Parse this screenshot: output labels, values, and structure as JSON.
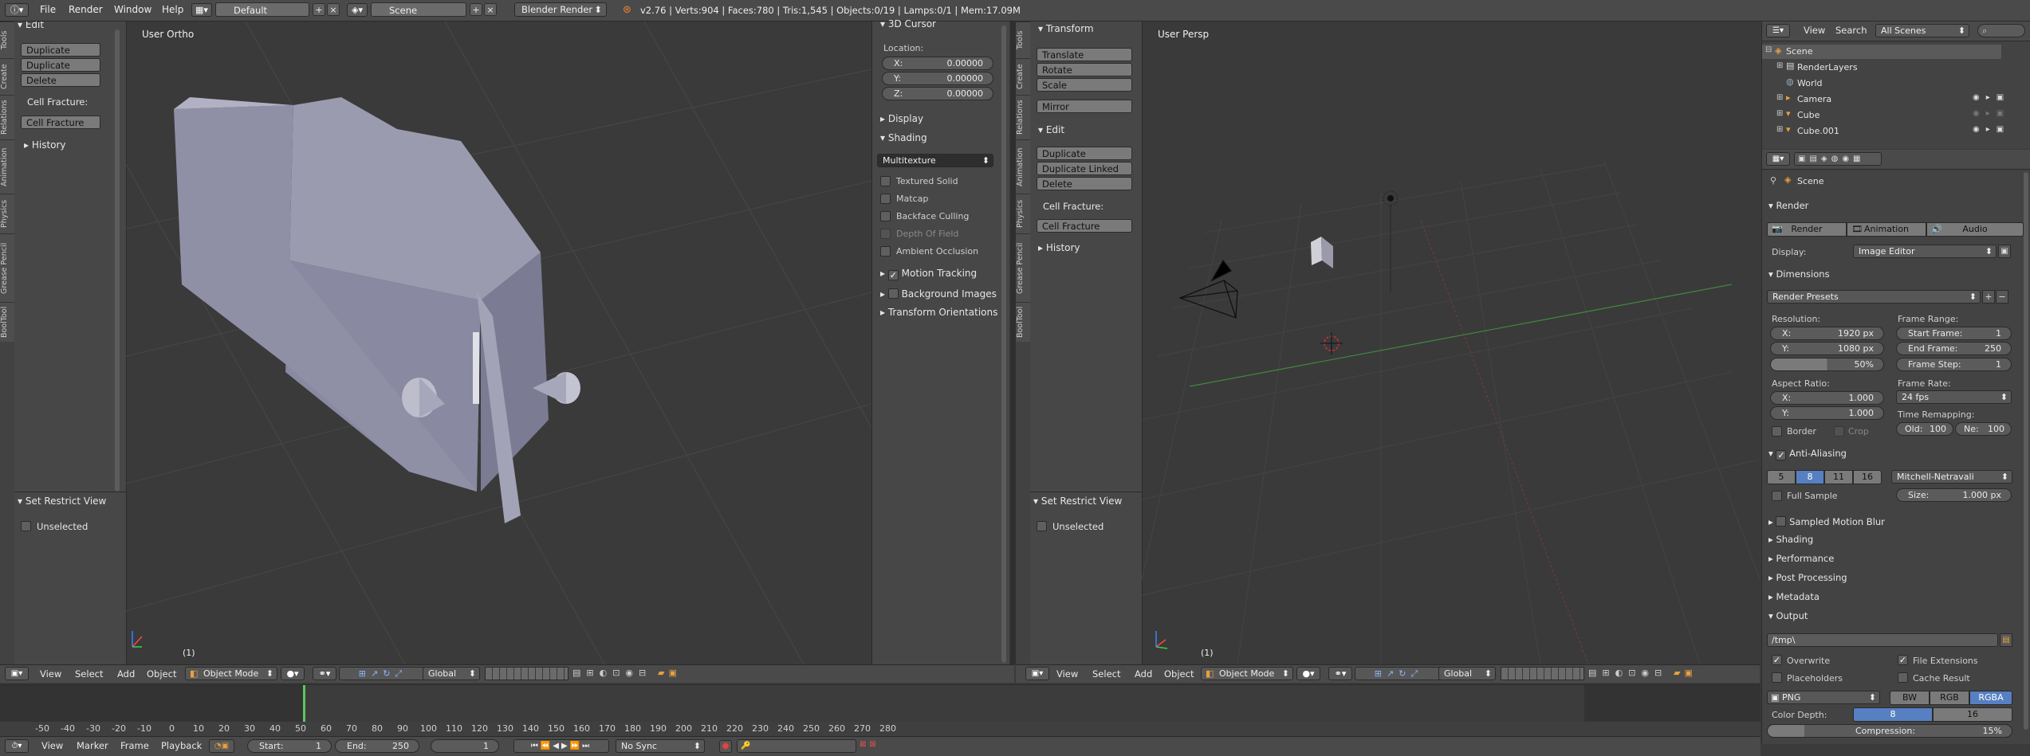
{
  "topbar": {
    "menus": [
      "File",
      "Render",
      "Window",
      "Help"
    ],
    "screen_layout": "Default",
    "scene": "Scene",
    "render_engine": "Blender Render",
    "stats": "v2.76 | Verts:904 | Faces:780 | Tris:1,545 | Objects:0/19 | Lamps:0/1 | Mem:17.09M"
  },
  "left_view": {
    "title": "User Ortho",
    "frame_label": "(1)",
    "tabs": [
      "Tools",
      "Create",
      "Relations",
      "Animation",
      "Physics",
      "Grease Pencil",
      "BoolTool"
    ],
    "edit_header": "Edit",
    "buttons": [
      "Duplicate",
      "Duplicate Linked",
      "Delete"
    ],
    "cell_fracture_label": "Cell Fracture:",
    "cell_fracture_button": "Cell Fracture",
    "history": "History",
    "restrict_header": "Set Restrict View",
    "unselected": "Unselected"
  },
  "n_panel": {
    "cursor_header": "3D Cursor",
    "location_label": "Location:",
    "loc": [
      {
        "k": "X:",
        "v": "0.00000"
      },
      {
        "k": "Y:",
        "v": "0.00000"
      },
      {
        "k": "Z:",
        "v": "0.00000"
      }
    ],
    "display": "Display",
    "shading": "Shading",
    "shading_mode": "Multitexture",
    "shading_opts": [
      "Textured Solid",
      "Matcap",
      "Backface Culling",
      "Depth Of Field",
      "Ambient Occlusion"
    ],
    "motion_tracking": "Motion Tracking",
    "background_images": "Background Images",
    "transform_orientations": "Transform Orientations"
  },
  "right_view": {
    "title": "User Persp",
    "frame_label": "(1)",
    "tabs": [
      "Tools",
      "Create",
      "Relations",
      "Animation",
      "Physics",
      "Grease Pencil",
      "BoolTool"
    ],
    "transform_header": "Transform",
    "transform_buttons": [
      "Translate",
      "Rotate",
      "Scale"
    ],
    "mirror": "Mirror",
    "edit_header": "Edit",
    "buttons": [
      "Duplicate",
      "Duplicate Linked",
      "Delete"
    ],
    "cell_fracture_label": "Cell Fracture:",
    "cell_fracture_button": "Cell Fracture",
    "history": "History",
    "restrict_header": "Set Restrict View",
    "unselected": "Unselected"
  },
  "view_header": {
    "menus": [
      "View",
      "Select",
      "Add",
      "Object"
    ],
    "mode": "Object Mode",
    "orientation": "Global"
  },
  "outliner": {
    "menu_view": "View",
    "menu_search": "Search",
    "filter": "All Scenes",
    "items": [
      "Scene",
      "RenderLayers",
      "World",
      "Camera",
      "Cube",
      "Cube.001"
    ]
  },
  "properties": {
    "context": "Scene",
    "render_header": "Render",
    "render_buttons": [
      "Render",
      "Animation",
      "Audio"
    ],
    "display_label": "Display:",
    "display_value": "Image Editor",
    "dimensions_header": "Dimensions",
    "render_presets": "Render Presets",
    "resolution_label": "Resolution:",
    "res_x": "1920 px",
    "res_y": "1080 px",
    "res_pct": "50%",
    "frame_range_label": "Frame Range:",
    "start_frame": "1",
    "end_frame": "250",
    "frame_step": "1",
    "aspect_label": "Aspect Ratio:",
    "aspect_x": "1.000",
    "aspect_y": "1.000",
    "frame_rate_label": "Frame Rate:",
    "frame_rate": "24 fps",
    "border": "Border",
    "crop": "Crop",
    "time_remap_label": "Time Remapping:",
    "old": "100",
    "new": "100",
    "aa_header": "Anti-Aliasing",
    "aa_samples": [
      "5",
      "8",
      "11",
      "16"
    ],
    "aa_filter": "Mitchell-Netravali",
    "full_sample": "Full Sample",
    "aa_size": "1.000 px",
    "collapsed": [
      "Sampled Motion Blur",
      "Shading",
      "Performance",
      "Post Processing",
      "Metadata"
    ],
    "output_header": "Output",
    "output_path": "/tmp\\",
    "overwrite": "Overwrite",
    "file_extensions": "File Extensions",
    "placeholders": "Placeholders",
    "cache_result": "Cache Result",
    "format": "PNG",
    "color_modes": [
      "BW",
      "RGB",
      "RGBA"
    ],
    "color_depth_label": "Color Depth:",
    "depths": [
      "8",
      "16"
    ],
    "compression": "15%"
  },
  "timeline": {
    "ticks": [
      "-50",
      "-40",
      "-30",
      "-20",
      "-10",
      "0",
      "10",
      "20",
      "30",
      "40",
      "50",
      "60",
      "70",
      "80",
      "90",
      "100",
      "110",
      "120",
      "130",
      "140",
      "150",
      "160",
      "170",
      "180",
      "190",
      "200",
      "210",
      "220",
      "230",
      "240",
      "250",
      "260",
      "270",
      "280"
    ],
    "menus": [
      "View",
      "Marker",
      "Frame",
      "Playback"
    ],
    "start": "1",
    "end": "250",
    "current": "1",
    "sync": "No Sync"
  }
}
